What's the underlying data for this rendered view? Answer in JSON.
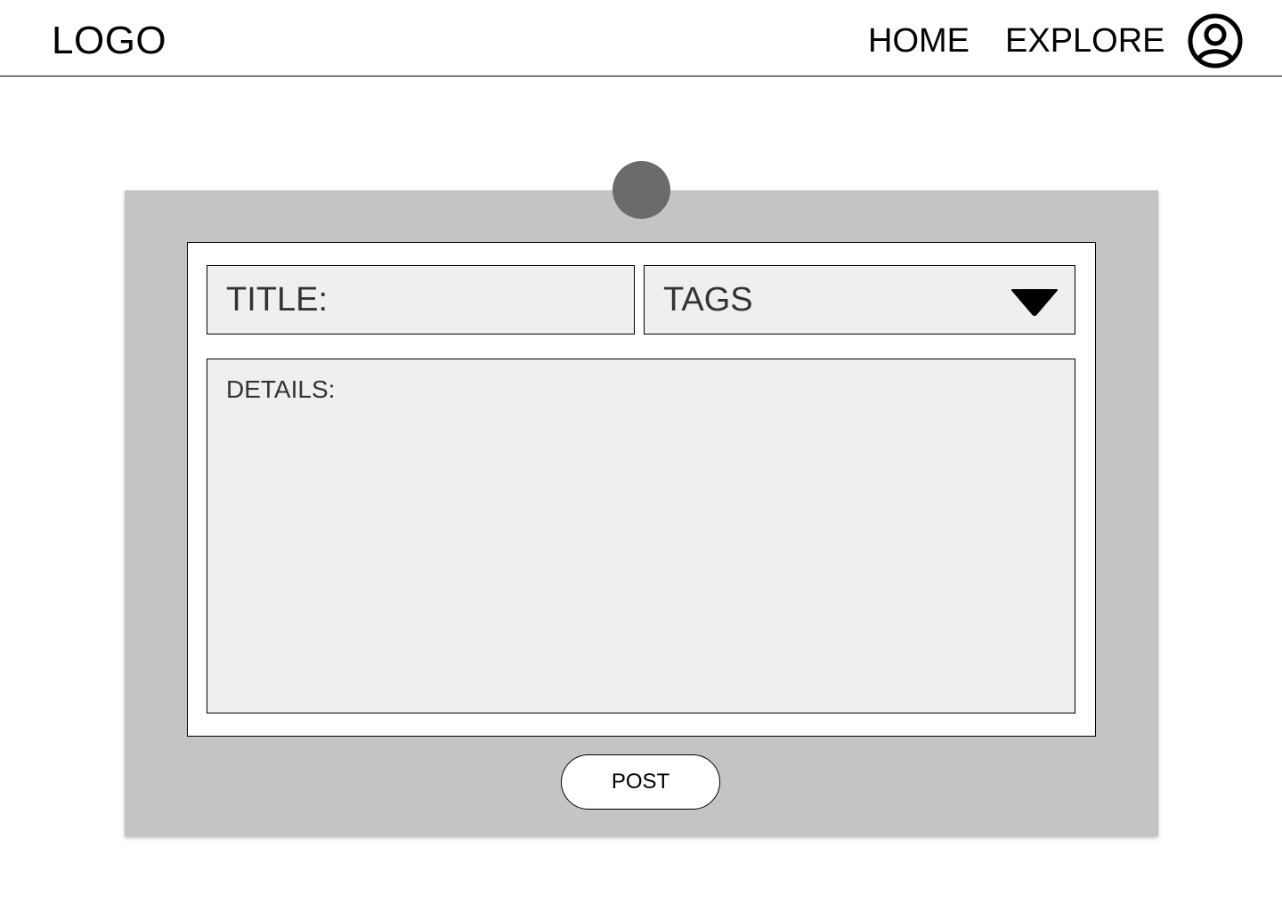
{
  "header": {
    "logo_text": "LOGO",
    "nav": [
      {
        "label": "HOME"
      },
      {
        "label": "EXPLORE"
      }
    ],
    "profile_icon": "user-circle-icon"
  },
  "post_form": {
    "pin_icon": "pin-icon",
    "title_placeholder": "TITLE:",
    "tags_placeholder": "TAGS",
    "tags_dropdown_icon": "triangle-down-icon",
    "details_placeholder": "DETAILS:",
    "post_button_label": "POST"
  },
  "colors": {
    "card_background": "#c4c4c4",
    "field_background": "#efefef",
    "pin": "#6b6b6b"
  }
}
